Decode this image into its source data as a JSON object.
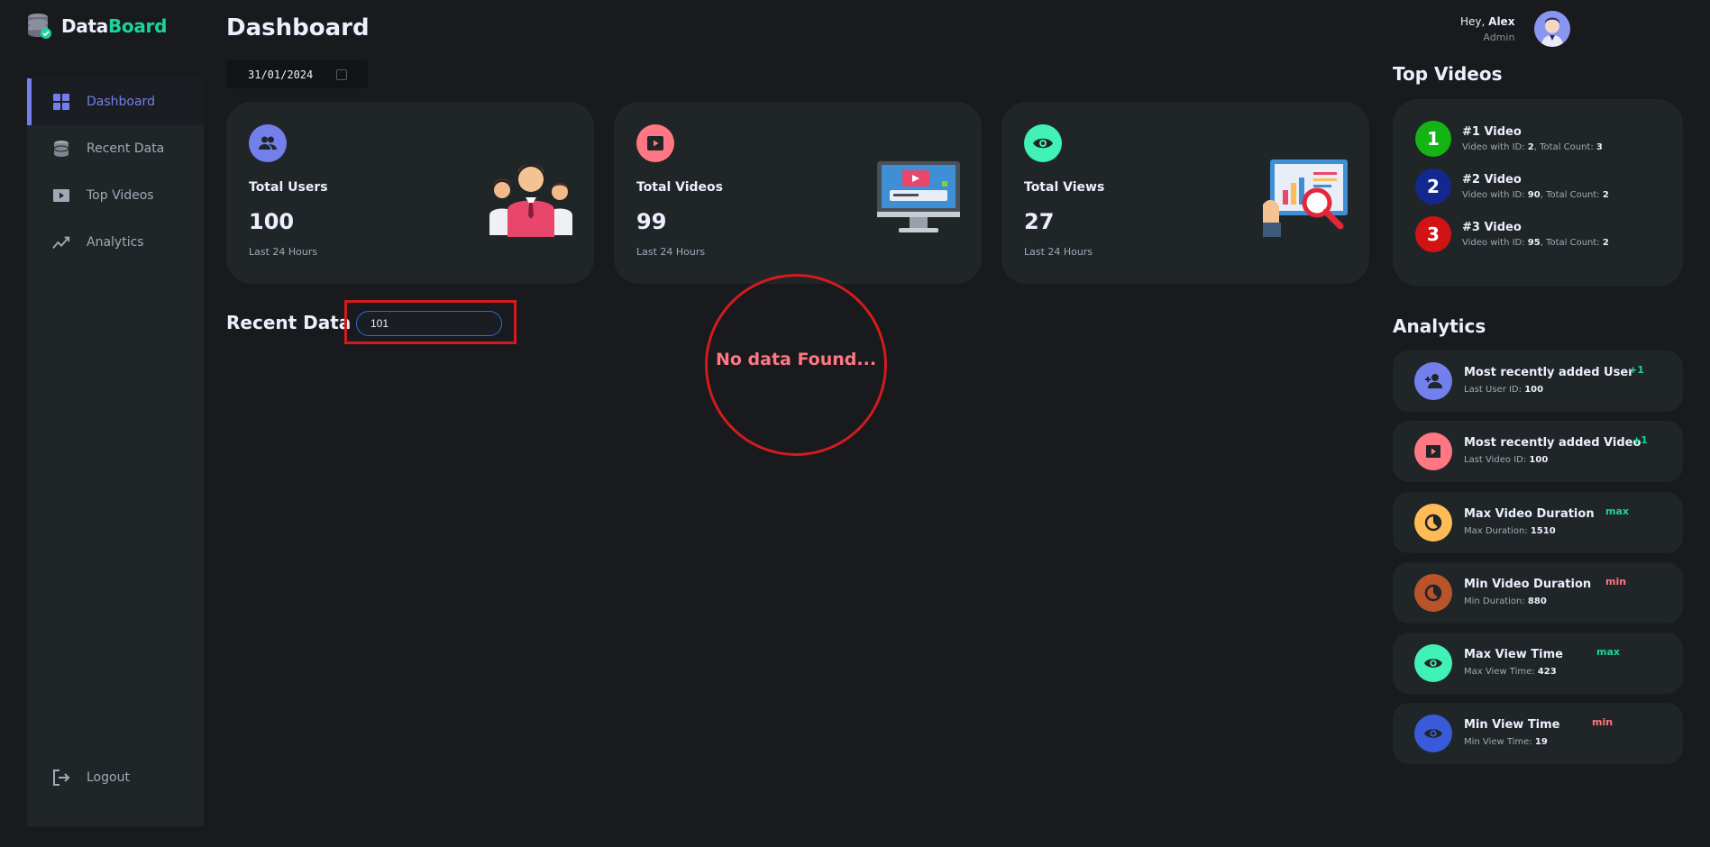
{
  "app": {
    "logo_first": "Data",
    "logo_second": "Board",
    "accent": "#7380ec",
    "success": "#1bd49b",
    "danger": "#ff7782"
  },
  "sidebar": {
    "items": [
      {
        "label": "Dashboard",
        "icon": "grid-icon",
        "active": true
      },
      {
        "label": "Recent Data",
        "icon": "database-icon"
      },
      {
        "label": "Top Videos",
        "icon": "play-icon"
      },
      {
        "label": "Analytics",
        "icon": "trend-icon"
      }
    ],
    "logout": {
      "label": "Logout",
      "icon": "logout-icon"
    }
  },
  "header": {
    "title": "Dashboard",
    "date": "31/01/2024",
    "greeting": "Hey,",
    "user_name": "Alex",
    "user_role": "Admin"
  },
  "cards": [
    {
      "label": "Total Users",
      "value": "100",
      "sub": "Last 24 Hours",
      "icon": "users-icon",
      "color": "#7380ec"
    },
    {
      "label": "Total Videos",
      "value": "99",
      "sub": "Last 24 Hours",
      "icon": "play-icon",
      "color": "#ff7782"
    },
    {
      "label": "Total Views",
      "value": "27",
      "sub": "Last 24 Hours",
      "icon": "eye-icon",
      "color": "#41f1b6"
    }
  ],
  "recent": {
    "title": "Recent Data",
    "search_value": "101",
    "empty_message": "No data Found..."
  },
  "top_videos": {
    "title": "Top Videos",
    "items": [
      {
        "rank": "1",
        "title": "#1 Video",
        "id_label": "Video with ID:",
        "id": "2",
        "count_label": "Total Count:",
        "count": "3",
        "color": "#13b413"
      },
      {
        "rank": "2",
        "title": "#2 Video",
        "id_label": "Video with ID:",
        "id": "90",
        "count_label": "Total Count:",
        "count": "2",
        "color": "#13288f"
      },
      {
        "rank": "3",
        "title": "#3 Video",
        "id_label": "Video with ID:",
        "id": "95",
        "count_label": "Total Count:",
        "count": "2",
        "color": "#d11313"
      }
    ]
  },
  "analytics": {
    "title": "Analytics",
    "items": [
      {
        "title": "Most recently added User",
        "sub_label": "Last User ID:",
        "sub_value": "100",
        "badge": "+1",
        "badge_color": "#1bd49b",
        "icon": "add-user-icon",
        "color": "#7380ec"
      },
      {
        "title": "Most recently added Video",
        "sub_label": "Last Video ID:",
        "sub_value": "100",
        "badge": "+1",
        "badge_color": "#1bd49b",
        "icon": "play-icon",
        "color": "#ff7782"
      },
      {
        "title": "Max Video Duration",
        "sub_label": "Max Duration:",
        "sub_value": "1510",
        "badge": "max",
        "badge_color": "#1bd49b",
        "icon": "timer-icon",
        "color": "#ffbb55"
      },
      {
        "title": "Min Video Duration",
        "sub_label": "Min Duration:",
        "sub_value": "880",
        "badge": "min",
        "badge_color": "#ff7782",
        "icon": "timer-icon",
        "color": "#b8532a"
      },
      {
        "title": "Max View Time",
        "sub_label": "Max View Time:",
        "sub_value": "423",
        "badge": "max",
        "badge_color": "#1bd49b",
        "icon": "eye-icon",
        "color": "#41f1b6"
      },
      {
        "title": "Min View Time",
        "sub_label": "Min View Time:",
        "sub_value": "19",
        "badge": "min",
        "badge_color": "#ff7782",
        "icon": "eye-icon",
        "color": "#3a5bd9"
      }
    ]
  }
}
